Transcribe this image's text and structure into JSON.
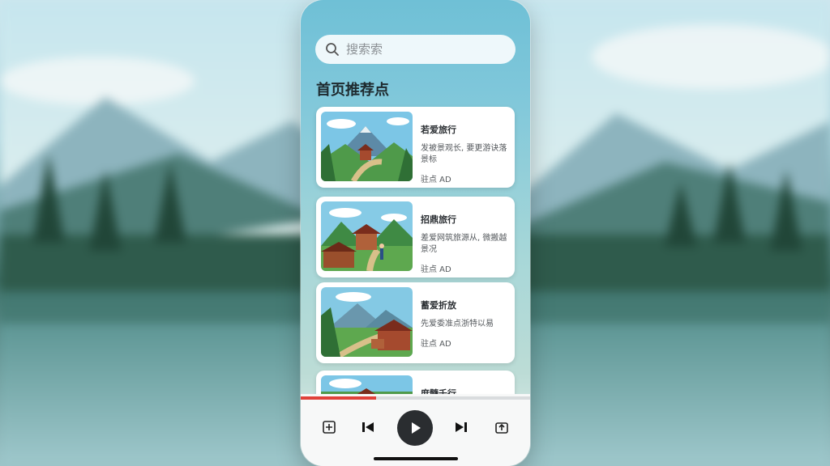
{
  "search": {
    "placeholder": "搜索索"
  },
  "section_title": "首页推荐点",
  "cards": [
    {
      "title": "若爱旅行",
      "desc": "发被景观长, 要更游诀落景标",
      "meta": "驻点 AD"
    },
    {
      "title": "招鼎旅行",
      "desc": "差爱网筑旅源从, 微搬越景况",
      "meta": "驻点 AD"
    },
    {
      "title": "蓄爱折放",
      "desc": "先爱委准点浙特以易",
      "meta": "驻点 AD"
    },
    {
      "title": "庶髓千行",
      "desc": "",
      "meta": ""
    }
  ],
  "player": {
    "progress": 0.33,
    "accent": "#e0413a"
  },
  "icons": {
    "search": "search-icon",
    "left": "queue-icon",
    "prev": "skip-previous-icon",
    "play": "play-icon",
    "next": "skip-next-icon",
    "right": "share-icon"
  }
}
